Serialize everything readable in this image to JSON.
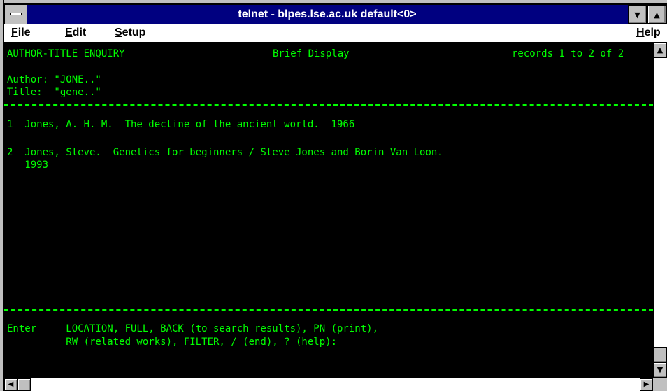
{
  "window": {
    "title": "telnet - blpes.lse.ac.uk default<0>"
  },
  "menu": {
    "file": "File",
    "edit": "Edit",
    "setup": "Setup",
    "help": "Help"
  },
  "terminal": {
    "header_left": "AUTHOR-TITLE ENQUIRY",
    "header_center": "Brief Display",
    "header_right": "records 1 to 2 of 2",
    "author_line": "Author: \"JONE..\"",
    "title_line": "Title:  \"gene..\"",
    "record1": "1  Jones, A. H. M.  The decline of the ancient world.  1966",
    "record2_line1": "2  Jones, Steve.  Genetics for beginners / Steve Jones and Borin Van Loon.",
    "record2_line2": "   1993",
    "prompt_line1": "Enter     LOCATION, FULL, BACK (to search results), PN (print),",
    "prompt_line2": "          RW (related works), FILTER, / (end), ? (help):"
  },
  "icons": {
    "system_menu": "system-menu-icon",
    "minimize": "minimize-arrow-icon",
    "maximize": "maximize-arrow-icon",
    "scroll_up": "arrow-up-icon",
    "scroll_down": "arrow-down-icon",
    "scroll_left": "arrow-left-icon",
    "scroll_right": "arrow-right-icon"
  },
  "colors": {
    "terminal_bg": "#000000",
    "terminal_fg": "#00ff00",
    "titlebar_bg": "#000080"
  }
}
